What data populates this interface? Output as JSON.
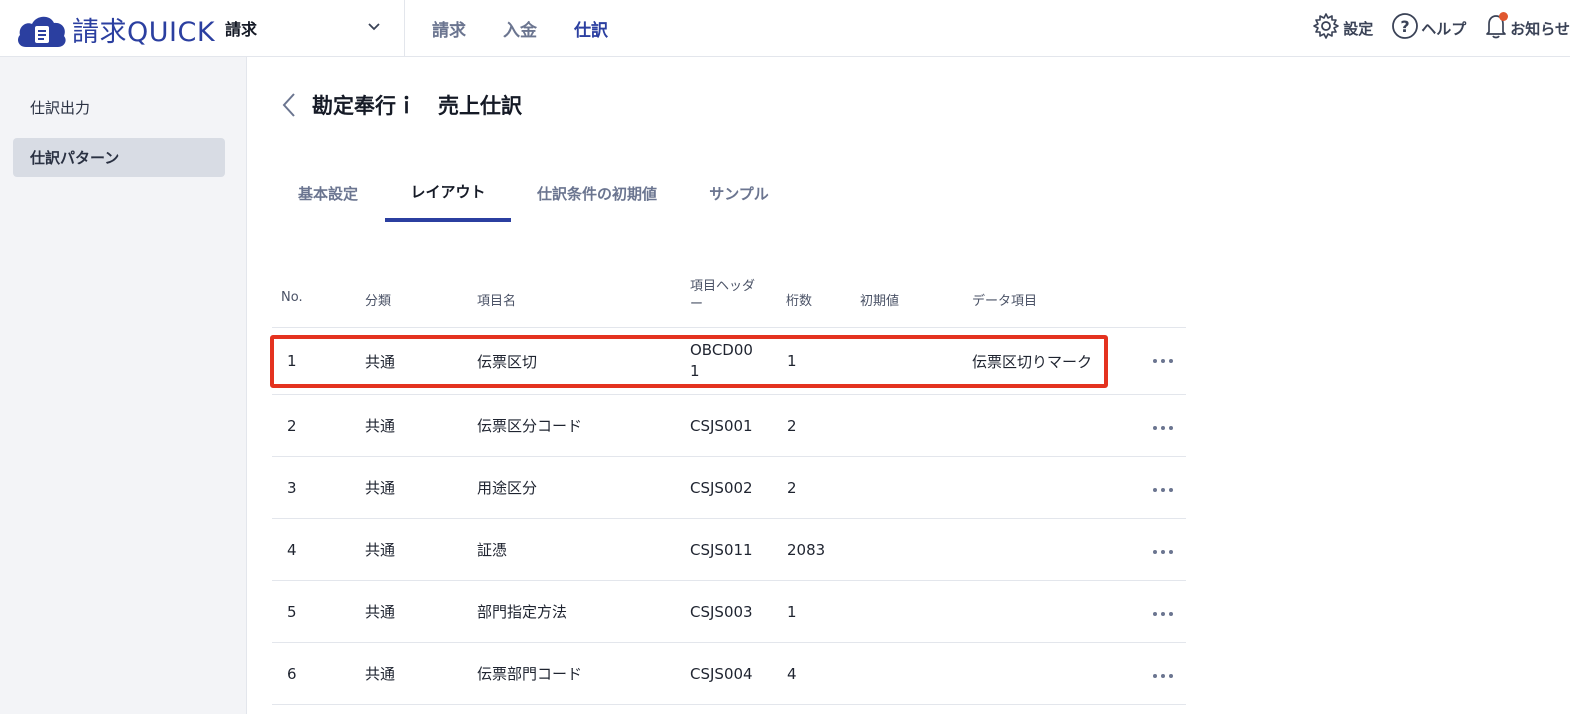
{
  "header": {
    "logo_text": "請求QUICK",
    "product_select": "請求",
    "nav": [
      "請求",
      "入金",
      "仕訳"
    ],
    "active_nav_index": 2,
    "settings_label": "設定",
    "help_label": "ヘルプ",
    "notifications_label": "お知らせ"
  },
  "sidebar": {
    "items": [
      {
        "label": "仕訳出力",
        "active": false
      },
      {
        "label": "仕訳パターン",
        "active": true
      }
    ]
  },
  "page": {
    "title": "勘定奉行ｉ　売上仕訳"
  },
  "tabs": [
    "基本設定",
    "レイアウト",
    "仕訳条件の初期値",
    "サンプル"
  ],
  "active_tab_index": 1,
  "table": {
    "headers": {
      "no": "No.",
      "category": "分類",
      "item_name": "項目名",
      "item_header": "項目ヘッダー",
      "digits": "桁数",
      "initial_value": "初期値",
      "data_item": "データ項目"
    },
    "rows": [
      {
        "no": "1",
        "category": "共通",
        "item_name": "伝票区切",
        "item_header": "OBCD001",
        "digits": "1",
        "initial_value": "",
        "data_item": "伝票区切りマーク",
        "highlighted": true
      },
      {
        "no": "2",
        "category": "共通",
        "item_name": "伝票区分コード",
        "item_header": "CSJS001",
        "digits": "2",
        "initial_value": "",
        "data_item": ""
      },
      {
        "no": "3",
        "category": "共通",
        "item_name": "用途区分",
        "item_header": "CSJS002",
        "digits": "2",
        "initial_value": "",
        "data_item": ""
      },
      {
        "no": "4",
        "category": "共通",
        "item_name": "証憑",
        "item_header": "CSJS011",
        "digits": "2083",
        "initial_value": "",
        "data_item": ""
      },
      {
        "no": "5",
        "category": "共通",
        "item_name": "部門指定方法",
        "item_header": "CSJS003",
        "digits": "1",
        "initial_value": "",
        "data_item": ""
      },
      {
        "no": "6",
        "category": "共通",
        "item_name": "伝票部門コード",
        "item_header": "CSJS004",
        "digits": "4",
        "initial_value": "",
        "data_item": ""
      }
    ]
  },
  "colors": {
    "brand": "#2b3fa0",
    "highlight": "#e4321f",
    "notification_dot": "#e0572f"
  }
}
